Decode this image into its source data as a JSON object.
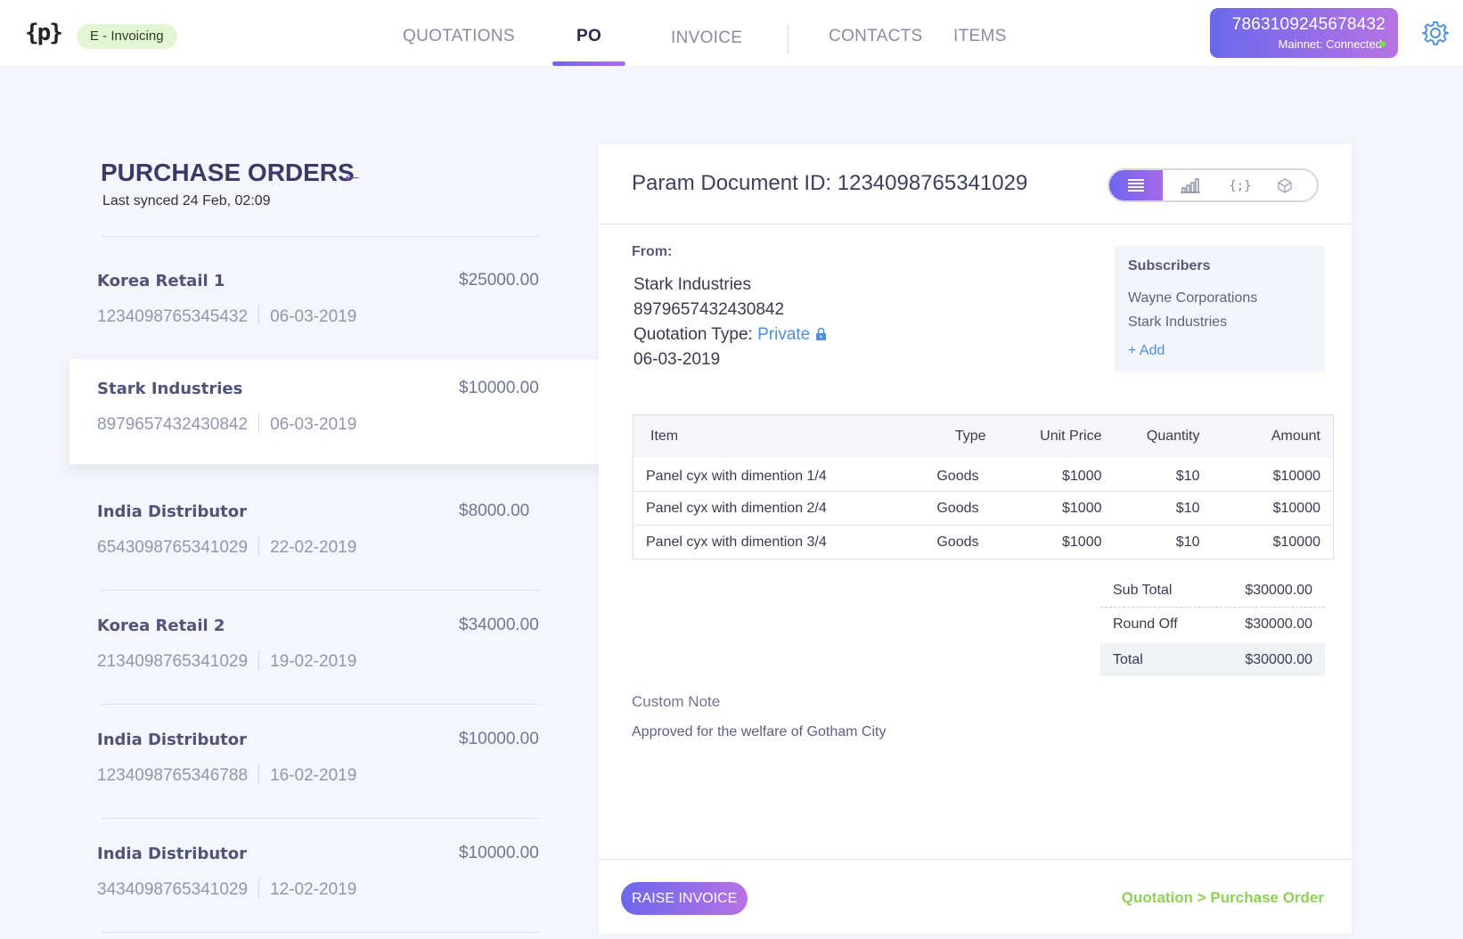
{
  "header": {
    "logo": "{p}",
    "app_badge": "E - Invoicing",
    "tabs": [
      {
        "label": "QUOTATIONS",
        "active": false
      },
      {
        "label": "PO",
        "active": true
      },
      {
        "label": "INVOICE",
        "active": false
      },
      {
        "label": "CONTACTS",
        "active": false
      },
      {
        "label": "ITEMS",
        "active": false
      }
    ],
    "account": {
      "id": "7863109245678432",
      "network": "Mainnet: Connected"
    },
    "accent_color": "#7a66ee"
  },
  "list": {
    "title": "PURCHASE ORDERS",
    "back_icon": "arrow-left-icon",
    "synced": "Last synced 24 Feb, 02:09",
    "items": [
      {
        "name": "Korea Retail 1",
        "amount": "$25000.00",
        "id": "1234098765345432",
        "date": "06-03-2019"
      },
      {
        "name": "Stark Industries",
        "amount": "$10000.00",
        "id": "8979657432430842",
        "date": "06-03-2019",
        "selected": true
      },
      {
        "name": "India Distributor",
        "amount": "$8000.00",
        "id": "6543098765341029",
        "date": "22-02-2019"
      },
      {
        "name": "Korea Retail 2",
        "amount": "$34000.00",
        "id": "2134098765341029",
        "date": "19-02-2019"
      },
      {
        "name": "India Distributor",
        "amount": "$10000.00",
        "id": "1234098765346788",
        "date": "16-02-2019"
      },
      {
        "name": "India Distributor",
        "amount": "$10000.00",
        "id": "3434098765341029",
        "date": "12-02-2019"
      }
    ]
  },
  "detail": {
    "doc_title": "Param Document ID: 1234098765341029",
    "view_icons": [
      "list-icon",
      "bar-chart-icon",
      "code-braces-icon",
      "cube-icon"
    ],
    "from_label": "From:",
    "from": {
      "company": "Stark Industries",
      "id": "8979657432430842",
      "quotation_type_label": "Quotation Type:",
      "quotation_type": "Private",
      "date": "06-03-2019"
    },
    "subscribers": {
      "title": "Subscribers",
      "items": [
        "Wayne Corporations",
        "Stark Industries"
      ],
      "add": "+ Add"
    },
    "table": {
      "headers": [
        "Item",
        "Type",
        "Unit Price",
        "Quantity",
        "Amount"
      ],
      "rows": [
        [
          "Panel cyx with dimention 1/4",
          "Goods",
          "$1000",
          "$10",
          "$10000"
        ],
        [
          "Panel cyx with dimention 2/4",
          "Goods",
          "$1000",
          "$10",
          "$10000"
        ],
        [
          "Panel cyx with dimention 3/4",
          "Goods",
          "$1000",
          "$10",
          "$10000"
        ]
      ]
    },
    "totals": {
      "sub_total_label": "Sub Total",
      "sub_total": "$30000.00",
      "round_off_label": "Round Off",
      "round_off": "$30000.00",
      "total_label": "Total",
      "total": "$30000.00"
    },
    "note": {
      "label": "Custom Note",
      "text": "Approved for the welfare of Gotham City"
    },
    "raise_button": "RAISE INVOICE",
    "flow": "Quotation > Purchase Order"
  }
}
